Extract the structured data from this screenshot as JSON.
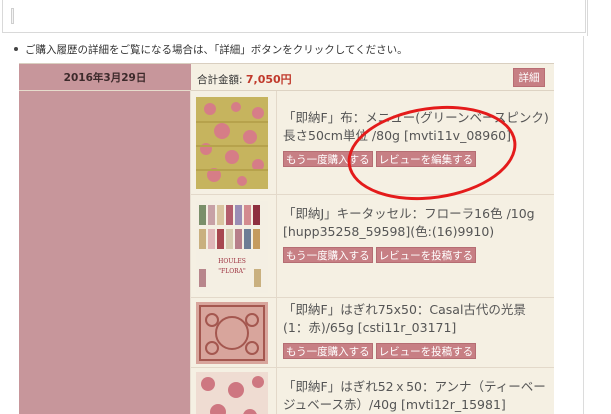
{
  "notice": {
    "text": "ご購入履歴の詳細をご覧になる場合は、「詳細」ボタンをクリックしてください。"
  },
  "order": {
    "date": "2016年3月29日",
    "total_label": "合計金額: ",
    "total_value": "7,050円",
    "detail_label": "詳細",
    "items": [
      {
        "title": "「即納F」布：メニュー(グリーンベースピンク)長さ50cm単位 /80g [mvti11v_08960]",
        "buttons": [
          "もう一度購入する",
          "レビューを編集する"
        ]
      },
      {
        "title": "「即納J」キータッセル：フローラ16色 /10g [hupp35258_59598](色:(16)9910)",
        "buttons": [
          "もう一度購入する",
          "レビューを投稿する"
        ],
        "thumb_caption_1": "HOULES",
        "thumb_caption_2": "\"FLORA\""
      },
      {
        "title": "「即納F」はぎれ75x50：Casal古代の光景(1：赤)/65g [csti11r_03171]",
        "buttons": [
          "もう一度購入する",
          "レビューを投稿する"
        ]
      },
      {
        "title": "「即納F」はぎれ52ｘ50：アンナ（ティーベージュベース赤）/40g [mvti12r_15981]",
        "buttons": []
      }
    ]
  },
  "colors": {
    "date_cell": "#c7969b",
    "row_bg": "#f5f0e3",
    "button": "#c77f84",
    "price": "#c0392b",
    "annotation": "#e41b1b"
  }
}
